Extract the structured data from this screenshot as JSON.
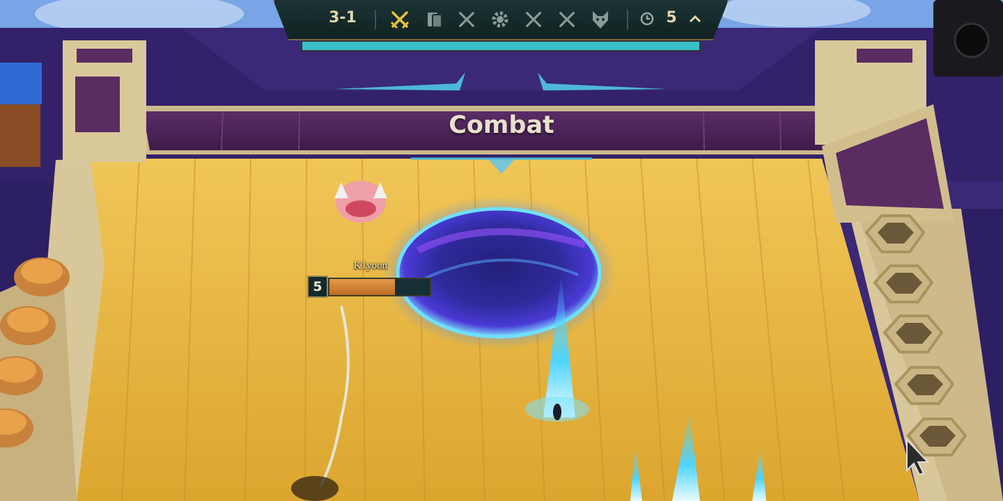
{
  "hud": {
    "stage": "3-1",
    "stage_icons": [
      {
        "name": "crossed-swords-icon",
        "active": true
      },
      {
        "name": "card-icon",
        "active": false
      },
      {
        "name": "crossed-swords-icon",
        "active": false
      },
      {
        "name": "carousel-gear-icon",
        "active": false
      },
      {
        "name": "crossed-swords-icon",
        "active": false
      },
      {
        "name": "crossed-swords-icon",
        "active": false
      },
      {
        "name": "wolf-head-icon",
        "active": false
      }
    ],
    "timer_icon": "clock-icon",
    "timer": "5",
    "expand_icon": "chevron-up-icon",
    "progress": 1.0
  },
  "phase_banner": {
    "title": "Combat"
  },
  "player": {
    "name": "K1yoon",
    "level": "5",
    "health_fraction": 0.65
  },
  "colors": {
    "accent_teal": "#38c0c6",
    "active_icon_gold": "#e8c23a",
    "inactive_icon": "#8a9a9a",
    "health_orange": "#d4823a",
    "board_gold": "#e8b63c",
    "arena_purple": "#3b2876"
  }
}
